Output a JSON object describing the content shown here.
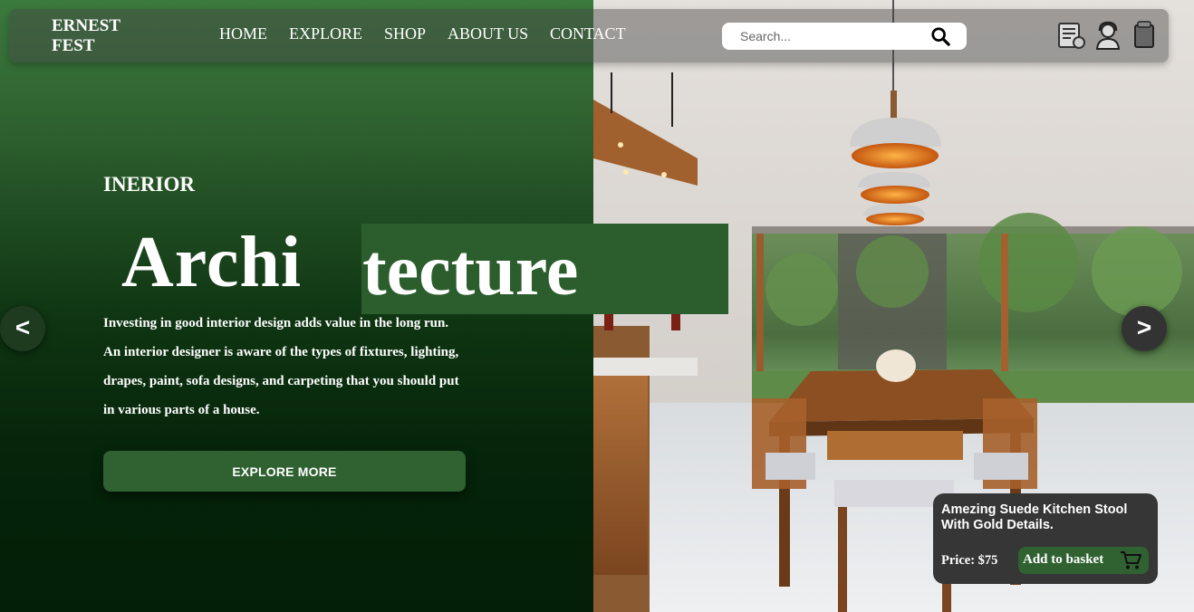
{
  "brand": {
    "line1": "ERNEST",
    "line2": "FEST"
  },
  "nav": {
    "items": [
      "HOME",
      "EXPLORE",
      "SHOP",
      "ABOUT US",
      "CONTACT"
    ]
  },
  "search": {
    "placeholder": "Search...",
    "icon": "search-icon"
  },
  "header_icons": [
    "checklist-icon",
    "support-agent-icon",
    "basket-icon"
  ],
  "hero": {
    "eyebrow": "INERIOR",
    "title_part1": "Archi",
    "title_part2": "tecture",
    "description": [
      "Investing in good interior design adds value in the long run.",
      "An interior designer is aware of the types of fixtures, lighting,",
      "drapes, paint, sofa designs, and carpeting that you should put",
      "in various parts of a house."
    ],
    "cta_label": "EXPLORE MORE"
  },
  "carousel": {
    "prev_label": "<",
    "next_label": ">"
  },
  "product": {
    "title": "Amezing Suede Kitchen Stool With Gold Details.",
    "price": "Price: $75",
    "button_label": "Add to basket",
    "icon": "cart-icon"
  },
  "colors": {
    "accent": "#2f6131",
    "dark": "#363636"
  }
}
